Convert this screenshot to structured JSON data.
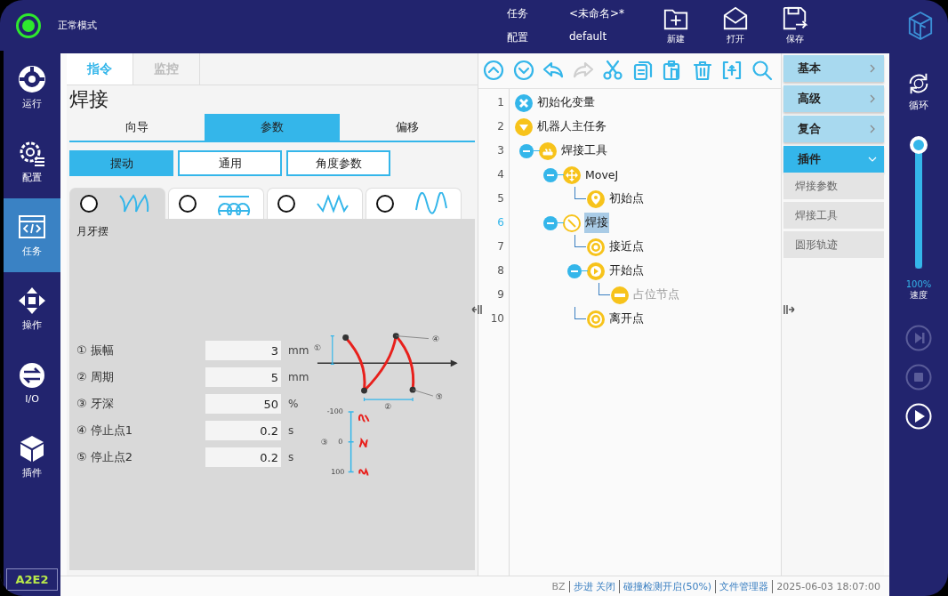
{
  "top_bar": {
    "mode": "正常模式",
    "mode_on": true,
    "task_label": "任务",
    "task_value": "<未命名>*",
    "config_label": "配置",
    "config_value": "default",
    "actions": [
      {
        "label": "新建",
        "kind": "new"
      },
      {
        "label": "打开",
        "kind": "open"
      },
      {
        "label": "保存",
        "kind": "save"
      }
    ]
  },
  "nav": {
    "items": [
      {
        "label": "运行",
        "kind": "run",
        "selected": false
      },
      {
        "label": "配置",
        "kind": "config",
        "selected": false
      },
      {
        "label": "任务",
        "kind": "task",
        "selected": true
      },
      {
        "label": "操作",
        "kind": "operate",
        "selected": false
      },
      {
        "label": "I/O",
        "kind": "io",
        "selected": false
      },
      {
        "label": "插件",
        "kind": "plugin",
        "selected": false
      }
    ],
    "badge": "A2E2"
  },
  "editor": {
    "tabs": [
      {
        "label": "指令",
        "selected": true
      },
      {
        "label": "监控",
        "selected": false
      }
    ],
    "title": "焊接",
    "sub_tabs": [
      {
        "label": "向导",
        "selected": false
      },
      {
        "label": "参数",
        "selected": true
      },
      {
        "label": "偏移",
        "selected": false
      }
    ],
    "section_buttons": [
      {
        "label": "摆动",
        "selected": true
      },
      {
        "label": "通用",
        "selected": false
      },
      {
        "label": "角度参数",
        "selected": false
      }
    ],
    "patterns": [
      {
        "kind": "crescent",
        "selected": true
      },
      {
        "kind": "loops",
        "selected": false
      },
      {
        "kind": "zigzag",
        "selected": false
      },
      {
        "kind": "sine",
        "selected": false
      }
    ],
    "pattern_name": "月牙摆",
    "params": [
      {
        "index": "①",
        "label": "振幅",
        "value": "3",
        "unit": "mm"
      },
      {
        "index": "②",
        "label": "周期",
        "value": "5",
        "unit": "mm"
      },
      {
        "index": "③",
        "label": "牙深",
        "value": "50",
        "unit": "%"
      },
      {
        "index": "④",
        "label": "停止点1",
        "value": "0.2",
        "unit": "s"
      },
      {
        "index": "⑤",
        "label": "停止点2",
        "value": "0.2",
        "unit": "s"
      }
    ],
    "diagram_labels": {
      "amplitude": "①",
      "period": "②",
      "depth": "③",
      "stop1": "④",
      "stop2": "⑤",
      "depth_min": "-100",
      "depth_mid": "0",
      "depth_max": "100"
    }
  },
  "tree": {
    "toolbar": [
      {
        "kind": "up",
        "disabled": false
      },
      {
        "kind": "down",
        "disabled": false
      },
      {
        "kind": "undo",
        "disabled": false
      },
      {
        "kind": "redo",
        "disabled": true
      },
      {
        "kind": "cut",
        "disabled": false
      },
      {
        "kind": "copy",
        "disabled": false
      },
      {
        "kind": "paste",
        "disabled": false
      },
      {
        "kind": "delete",
        "disabled": false
      },
      {
        "kind": "insert",
        "disabled": false
      },
      {
        "kind": "search",
        "disabled": false
      }
    ],
    "nodes": [
      {
        "line": "1",
        "label": "初始化变量",
        "kind": "variable",
        "selected": false,
        "disabled": false
      },
      {
        "line": "2",
        "label": "机器人主任务",
        "kind": "main",
        "selected": false,
        "disabled": false,
        "children": [
          {
            "line": "3",
            "label": "焊接工具",
            "kind": "tool",
            "selected": false,
            "disabled": false,
            "expanded": true,
            "children": [
              {
                "line": "4",
                "label": "MoveJ",
                "kind": "move",
                "selected": false,
                "disabled": false,
                "expanded": true,
                "children": [
                  {
                    "line": "5",
                    "label": "初始点",
                    "kind": "pin",
                    "selected": false,
                    "disabled": false
                  }
                ]
              },
              {
                "line": "6",
                "label": "焊接",
                "kind": "weld",
                "selected": true,
                "disabled": false,
                "expanded": true,
                "children": [
                  {
                    "line": "7",
                    "label": "接近点",
                    "kind": "target",
                    "selected": false,
                    "disabled": false
                  },
                  {
                    "line": "8",
                    "label": "开始点",
                    "kind": "start",
                    "selected": false,
                    "disabled": false,
                    "expanded": true,
                    "children": [
                      {
                        "line": "9",
                        "label": "占位节点",
                        "kind": "placeholder",
                        "selected": false,
                        "disabled": true
                      }
                    ]
                  },
                  {
                    "line": "10",
                    "label": "离开点",
                    "kind": "target",
                    "selected": false,
                    "disabled": false
                  }
                ]
              }
            ]
          }
        ]
      }
    ]
  },
  "commands": [
    {
      "label": "基本",
      "expanded": false
    },
    {
      "label": "高级",
      "expanded": false
    },
    {
      "label": "复合",
      "expanded": false
    },
    {
      "label": "插件",
      "expanded": true,
      "children": [
        "焊接参数",
        "焊接工具",
        "圆形轨迹"
      ]
    }
  ],
  "run_bar": {
    "loop_label": "循环",
    "speed": {
      "level": 1.0,
      "reading": "100%",
      "label": "速度"
    },
    "buttons": [
      {
        "kind": "step",
        "disabled": true
      },
      {
        "kind": "stop",
        "disabled": true
      },
      {
        "kind": "play",
        "disabled": false
      }
    ]
  },
  "status_bar": [
    {
      "kind": "bz",
      "label": "BZ"
    },
    {
      "kind": "step",
      "label": "步进 关闭"
    },
    {
      "kind": "collision",
      "label": "碰撞检测开启(50%)"
    },
    {
      "kind": "files",
      "label": "文件管理器"
    },
    {
      "kind": "time",
      "label": "2025-06-03 18:07:00"
    }
  ]
}
